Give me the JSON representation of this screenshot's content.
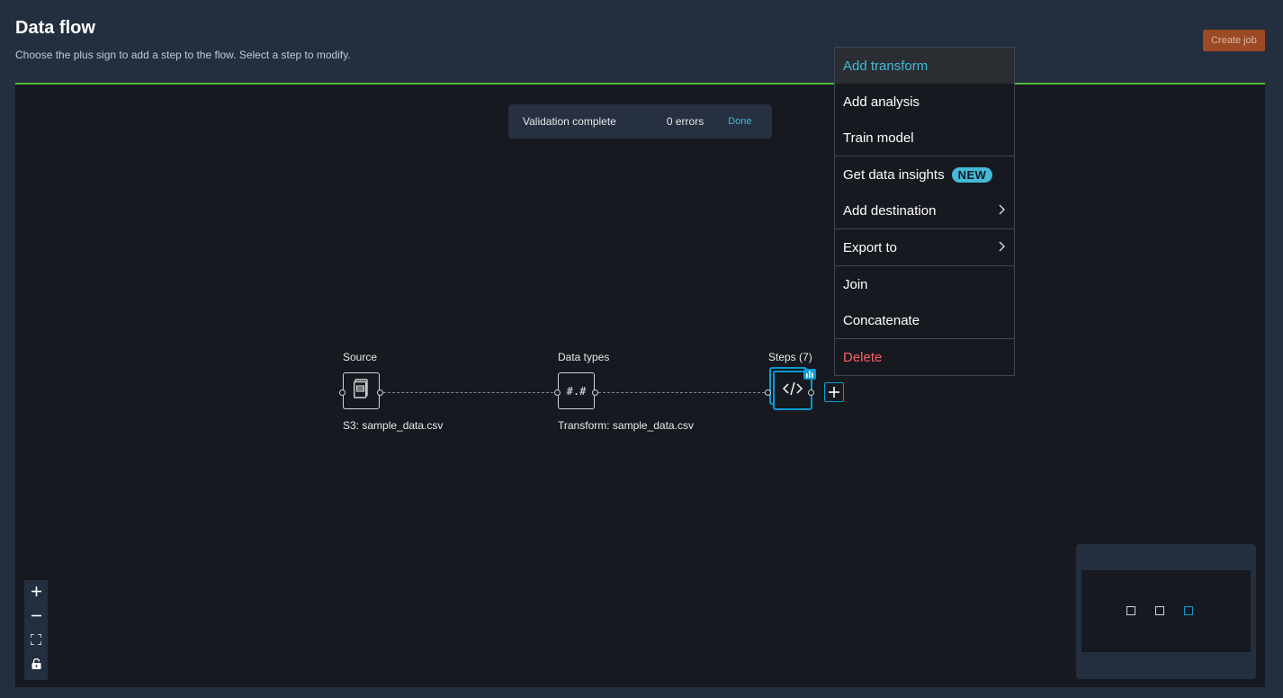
{
  "header": {
    "title": "Data flow",
    "subtitle": "Choose the plus sign to add a step to the flow. Select a step to modify."
  },
  "actions": {
    "create_job": "Create job"
  },
  "validation": {
    "status": "Validation complete",
    "errors": "0 errors",
    "done": "Done"
  },
  "nodes": [
    {
      "title": "Source",
      "caption": "S3: sample_data.csv",
      "icon": "document-icon"
    },
    {
      "title": "Data types",
      "caption": "Transform: sample_data.csv",
      "icon_text": "#.#"
    },
    {
      "title": "Steps (7)",
      "caption": "",
      "icon": "code-icon"
    }
  ],
  "menu": {
    "items": [
      {
        "label": "Add transform"
      },
      {
        "label": "Add analysis"
      },
      {
        "label": "Train model"
      },
      {
        "label": "Get data insights",
        "badge": "NEW"
      },
      {
        "label": "Add destination"
      },
      {
        "label": "Export to"
      },
      {
        "label": "Join"
      },
      {
        "label": "Concatenate"
      },
      {
        "label": "Delete"
      }
    ]
  },
  "colors": {
    "accent": "#0a9ad4",
    "link": "#44b9d6",
    "success": "#4fbb37",
    "danger": "#ff5d64",
    "create_job": "#9c4a24"
  }
}
